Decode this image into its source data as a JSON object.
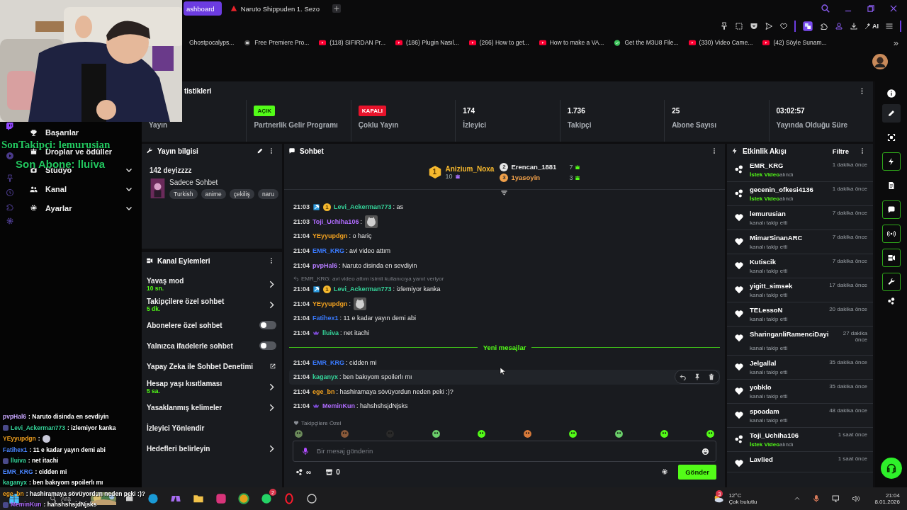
{
  "browser": {
    "tabs": [
      {
        "label": "ashboard",
        "selected": true
      },
      {
        "label": "Naruto Shippuden 1. Sezo",
        "selected": false
      }
    ],
    "ai_label": "AI",
    "bookmarks": [
      {
        "label": "Ghostpocalyps..."
      },
      {
        "label": "Free Premiere Pro...",
        "kind": "site"
      },
      {
        "label": "(118) SIFIRDAN Pr...",
        "kind": "youtube"
      },
      {
        "label": "(186) Plugin Nasıl...",
        "kind": "youtube"
      },
      {
        "label": "(266) How to get...",
        "kind": "youtube"
      },
      {
        "label": "How to make a VA...",
        "kind": "youtube"
      },
      {
        "label": "Get the M3U8 File...",
        "kind": "verified"
      },
      {
        "label": "(330) Video Came...",
        "kind": "youtube"
      },
      {
        "label": "(42) Söyle Sunam...",
        "kind": "youtube"
      }
    ],
    "more": "»"
  },
  "overlay": {
    "last_follower": "SonTakipçi: lemurusian",
    "last_sub": "Son Abone: lluiva",
    "chat": [
      {
        "user": "pvpHal6",
        "color": "#c9a8ff",
        "text": ": Naruto disinda en sevdiyin"
      },
      {
        "user": "Levi_Ackerman773",
        "color": "#35d49a",
        "text": ": izlemiyor kanka",
        "badges": true
      },
      {
        "user": "YEyyupdgn",
        "color": "#f0a020",
        "text": ":",
        "emote": true
      },
      {
        "user": "Fatihex1",
        "color": "#4a86ff",
        "text": ": 11 e kadar yayın demi abi"
      },
      {
        "user": "lluiva",
        "color": "#35d49a",
        "text": ": net itachi",
        "badges": true
      },
      {
        "user": "EMR_KRG",
        "color": "#4a86ff",
        "text": ": cidden mi"
      },
      {
        "user": "kaganyx",
        "color": "#35d49a",
        "text": ": ben bakıyom spoilerlı mı"
      },
      {
        "user": "ege_bn",
        "color": "#f0a020",
        "text": ": hashiramaya sövüyordun neden peki :)?"
      },
      {
        "user": "MeminKun",
        "color": "#b06cff",
        "text": ": hahshshsjdNjsks",
        "badges": true
      }
    ]
  },
  "sidebar": {
    "items": [
      {
        "label": "Başarılar",
        "kind": "link"
      },
      {
        "label": "Droplar ve ödüller",
        "kind": "link"
      },
      {
        "label": "Stüdyo",
        "kind": "group",
        "expanded": false
      },
      {
        "label": "Kanal",
        "kind": "group",
        "expanded": false
      },
      {
        "label": "Ayarlar",
        "kind": "group",
        "expanded": false
      }
    ]
  },
  "stats": {
    "title": "tistikleri",
    "cells": [
      {
        "label": "Yayın"
      },
      {
        "label": "Partnerlik Gelir Programı",
        "badge": {
          "text": "AÇIK",
          "on": true
        }
      },
      {
        "label": "Çoklu Yayın",
        "badge": {
          "text": "KAPALI",
          "on": false
        }
      },
      {
        "value": "174",
        "label": "İzleyici"
      },
      {
        "value": "1.736",
        "label": "Takipçi"
      },
      {
        "value": "25",
        "label": "Abone Sayısı"
      },
      {
        "value": "03:02:57",
        "label": "Yayında Olduğu Süre"
      }
    ]
  },
  "stream_info": {
    "title": "Yayın bilgisi",
    "stream_title": "142 deyizzzz",
    "category": "Sadece Sohbet",
    "tags": [
      "Turkish",
      "anime",
      "çekiliş",
      "naru"
    ]
  },
  "channel_actions": {
    "title": "Kanal Eylemleri",
    "items": [
      {
        "label": "Yavaş mod",
        "sub": "10 sn.",
        "kind": "link"
      },
      {
        "label": "Takipçilere özel sohbet",
        "sub": "5 dk.",
        "kind": "link"
      },
      {
        "label": "Abonelere özel sohbet",
        "kind": "toggle",
        "on": false
      },
      {
        "label": "Yalnızca ifadelerle sohbet",
        "kind": "toggle",
        "on": false
      },
      {
        "label": "Yapay Zeka ile Sohbet Denetimi",
        "kind": "external"
      },
      {
        "label": "Hesap yaşı kısıtlaması",
        "sub": "5 sa.",
        "kind": "link"
      },
      {
        "label": "Yasaklanmış kelimeler",
        "kind": "link"
      },
      {
        "label": "İzleyici Yönlendir",
        "kind": "plain"
      },
      {
        "label": "Hedefleri belirleyin",
        "kind": "link"
      }
    ]
  },
  "chat": {
    "title": "Sohbet",
    "leaders": [
      {
        "rank": "1",
        "name": "Anizium_Noxa",
        "count": "10",
        "color": "#f5b82e"
      },
      {
        "rank": "2",
        "name": "Erencan_1881",
        "count": "7",
        "color": "#e6e6e6"
      },
      {
        "rank": "3",
        "name": "1yasoyin",
        "count": "3",
        "color": "#f0a04a"
      }
    ],
    "messages": [
      {
        "kind": "message",
        "time": "21:03",
        "user": "Levi_Ackerman773",
        "color": "#35d49a",
        "badges": [
          {
            "kind": "mod"
          },
          {
            "kind": "rank",
            "label": "1"
          }
        ],
        "text": ": as",
        "highlighted": false
      },
      {
        "kind": "message",
        "time": "21:03",
        "user": "Toji_Uchiha106",
        "color": "#b06cff",
        "text": ":",
        "emote": true,
        "highlighted": false
      },
      {
        "kind": "message",
        "time": "21:04",
        "user": "YEyyupdgn",
        "color": "#f0a020",
        "text": ": o hariç",
        "highlighted": false
      },
      {
        "kind": "message",
        "time": "21:04",
        "user": "EMR_KRG",
        "color": "#3a7bff",
        "text": ": avi video attım",
        "highlighted": false
      },
      {
        "kind": "message",
        "time": "21:04",
        "user": "pvpHal6",
        "color": "#b57cff",
        "text": ": Naruto disinda en sevdiyin",
        "highlighted": false
      },
      {
        "kind": "message",
        "reply": "EMR_KRG: avi video attım isimli kullanıcıya yanıt veriyor",
        "time": "21:04",
        "user": "Levi_Ackerman773",
        "color": "#35d49a",
        "badges": [
          {
            "kind": "mod"
          },
          {
            "kind": "rank",
            "label": "1"
          }
        ],
        "text": ": izlemiyor kanka",
        "highlighted": false
      },
      {
        "kind": "message",
        "time": "21:04",
        "user": "YEyyupdgn",
        "color": "#f0a020",
        "text": ":",
        "emote": true,
        "highlighted": false
      },
      {
        "kind": "message",
        "time": "21:04",
        "user": "Fatihex1",
        "color": "#3a7bff",
        "text": ": 11 e kadar yayın demi abi",
        "highlighted": false
      },
      {
        "kind": "message",
        "time": "21:04",
        "user": "lluiva",
        "color": "#35d49a",
        "badges": [
          {
            "kind": "sub"
          }
        ],
        "text": ": net itachi",
        "highlighted": false
      },
      {
        "kind": "divider",
        "label": "Yeni mesajlar"
      },
      {
        "kind": "message",
        "time": "21:04",
        "user": "EMR_KRG",
        "color": "#3a7bff",
        "text": ": cidden mi",
        "highlighted": false
      },
      {
        "kind": "message",
        "time": "21:04",
        "user": "kaganyx",
        "color": "#35d49a",
        "text": ": ben bakıyom spoilerlı mı",
        "highlighted": true
      },
      {
        "kind": "message",
        "time": "21:04",
        "user": "ege_bn",
        "color": "#f0a020",
        "text": ": hashiramaya sövüyordun neden peki :)?",
        "highlighted": false
      },
      {
        "kind": "message",
        "time": "21:04",
        "user": "MeminKun",
        "color": "#b06cff",
        "badges": [
          {
            "kind": "sub"
          }
        ],
        "text": ": hahshshsjdNjsks",
        "highlighted": false
      }
    ],
    "emote_label": "Takipçilere Özel",
    "placeholder": "Bir mesaj gönderin",
    "points": "∞",
    "store_count": "0",
    "send": "Gönder"
  },
  "activity": {
    "title": "Etkinlik Akışı",
    "filter": "Filtre",
    "events": [
      {
        "kind": "gift",
        "name": "EMR_KRG",
        "time": "1 dakika önce",
        "highlight": "İstek Video",
        "detail": "alındı"
      },
      {
        "kind": "gift",
        "name": "gecenin_ofkesi4136",
        "time": "1 dakika önce",
        "highlight": "İstek Video",
        "detail": "alındı"
      },
      {
        "kind": "follow",
        "name": "lemurusian",
        "time": "7 dakika önce",
        "detail": "kanalı takip etti"
      },
      {
        "kind": "follow",
        "name": "MimarSinanARC",
        "time": "7 dakika önce",
        "detail": "kanalı takip etti"
      },
      {
        "kind": "follow",
        "name": "Kutiscik",
        "time": "7 dakika önce",
        "detail": "kanalı takip etti"
      },
      {
        "kind": "follow",
        "name": "yigitt_simsek",
        "time": "17 dakika önce",
        "detail": "kanalı takip etti"
      },
      {
        "kind": "follow",
        "name": "TELessoN",
        "time": "20 dakika önce",
        "detail": "kanalı takip etti"
      },
      {
        "kind": "follow",
        "name": "SharinganliRamenciDayi",
        "time": "27 dakika önce",
        "detail": "kanalı takip etti"
      },
      {
        "kind": "follow",
        "name": "Jelgallal",
        "time": "35 dakika önce",
        "detail": "kanalı takip etti"
      },
      {
        "kind": "follow",
        "name": "yobklo",
        "time": "35 dakika önce",
        "detail": "kanalı takip etti"
      },
      {
        "kind": "follow",
        "name": "spoadam",
        "time": "48 dakika önce",
        "detail": "kanalı takip etti"
      },
      {
        "kind": "gift",
        "name": "Toji_Uchiha106",
        "time": "1 saat önce",
        "highlight": "İstek Video",
        "detail": "alındı"
      },
      {
        "kind": "follow",
        "name": "Lavlied",
        "time": "1 saat önce"
      }
    ]
  },
  "taskbar": {
    "search_placeholder": "Ara",
    "app_badge": "2",
    "weather_badge": "3",
    "temperature": "12°C",
    "weather": "Çok bulutlu",
    "time": "21:04",
    "date": "8.01.2026"
  }
}
